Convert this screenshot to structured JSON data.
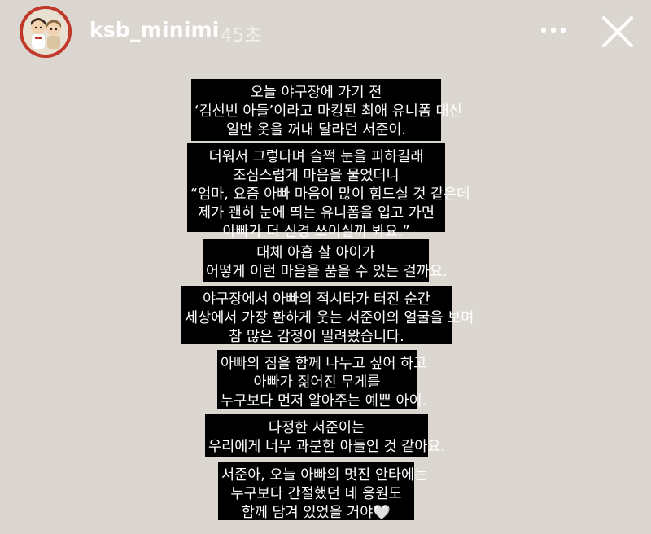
{
  "header": {
    "username": "ksb_minimi",
    "time": "45초",
    "more_icon": "more-horizontal-icon",
    "close_icon": "close-icon"
  },
  "blocks": [
    [
      "오늘 야구장에 가기 전",
      "‘김선빈 아들’이라고 마킹된 최애 유니폼 대신",
      "일반 옷을 꺼내 달라던 서준이."
    ],
    [
      "더워서 그렇다며 슬쩍 눈을 피하길래",
      "조심스럽게 마음을 물었더니",
      "“엄마, 요즘 아빠 마음이 많이 힘드실 것 같은데",
      "제가 괜히 눈에 띄는 유니폼을 입고 가면",
      "아빠가 더 신경 쓰이실까 봐요.”"
    ],
    [
      "대체 아홉 살 아이가",
      "어떻게 이런 마음을 품을 수 있는 걸까요."
    ],
    [
      "야구장에서 아빠의 적시타가 터진 순간",
      "세상에서 가장 환하게 웃는 서준이의 얼굴을 보며",
      "참 많은 감정이 밀려왔습니다."
    ],
    [
      "아빠의 짐을 함께 나누고 싶어 하고",
      "아빠가 짊어진 무게를",
      "누구보다 먼저 알아주는 예쁜 아이."
    ],
    [
      "다정한 서준이는",
      "우리에게 너무 과분한 아들인 것 같아요."
    ],
    [
      "서준아, 오늘 아빠의 멋진 안타에는",
      "누구보다 간절했던 네 응원도",
      "함께 담겨 있었을 거야🤍"
    ]
  ]
}
